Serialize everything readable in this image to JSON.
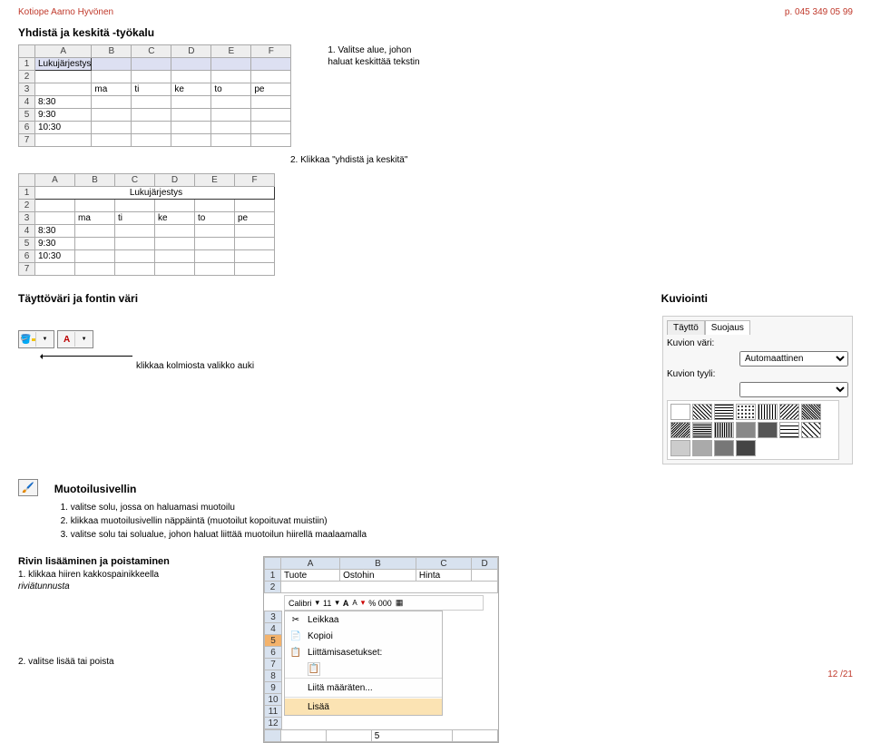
{
  "header": {
    "left": "Kotiope Aarno Hyvönen",
    "right": "p. 045 349 05 99"
  },
  "s1": {
    "title": "Yhdistä ja keskitä -työkalu"
  },
  "cap1a": "1. Valitse alue, johon",
  "cap1b": "haluat keskittää tekstin",
  "cap2": "2. Klikkaa \"yhdistä ja keskitä\"",
  "sheet1": {
    "selText": "Lukujärjestys",
    "r2": [
      "ma",
      "ti",
      "ke",
      "to",
      "pe"
    ],
    "r4": "8:30",
    "r5": "9:30",
    "r6": "10:30"
  },
  "sheet2": {
    "mergedText": "Lukujärjestys",
    "r2": [
      "ma",
      "ti",
      "ke",
      "to",
      "pe"
    ],
    "r4": "8:30",
    "r5": "9:30",
    "r6": "10:30"
  },
  "s2a": "Täyttöväri ja fontin väri",
  "s2b": "Kuviointi",
  "fill_caption": "klikkaa kolmiosta valikko auki",
  "panel": {
    "tab1": "Täyttö",
    "tab2": "Suojaus",
    "l1": "Kuvion väri:",
    "l2": "Kuvion tyyli:",
    "sel1": "Automaattinen"
  },
  "s3": {
    "title": "Muotoilusivellin",
    "i1": "valitse solu, jossa on haluamasi muotoilu",
    "i2": "klikkaa muotoilusivellin näppäintä (muotoilut kopoituvat muistiin)",
    "i3": "valitse solu tai solualue, johon haluat liittää muotoilun hiirellä maalaamalla"
  },
  "s4": {
    "title": "Rivin lisääminen ja poistaminen",
    "a": "1. klikkaa hiiren kakkospainikkeella",
    "b": "riviätunnusta",
    "final": "2. valitse lisää  tai poista"
  },
  "ctx_sheet": {
    "h": [
      "A",
      "B",
      "C",
      "D"
    ],
    "r1": [
      "1",
      "Tuote",
      "Ostohin",
      "Hinta"
    ]
  },
  "mini_tb": {
    "font": "Calibri",
    "size": "11",
    "pct": "% 000"
  },
  "menu": {
    "m1": "Leikkaa",
    "m2": "Kopioi",
    "m3": "Liittämisasetukset:",
    "m4": "Liitä määräten...",
    "m5": "Lisää"
  },
  "footer": "12 /21"
}
